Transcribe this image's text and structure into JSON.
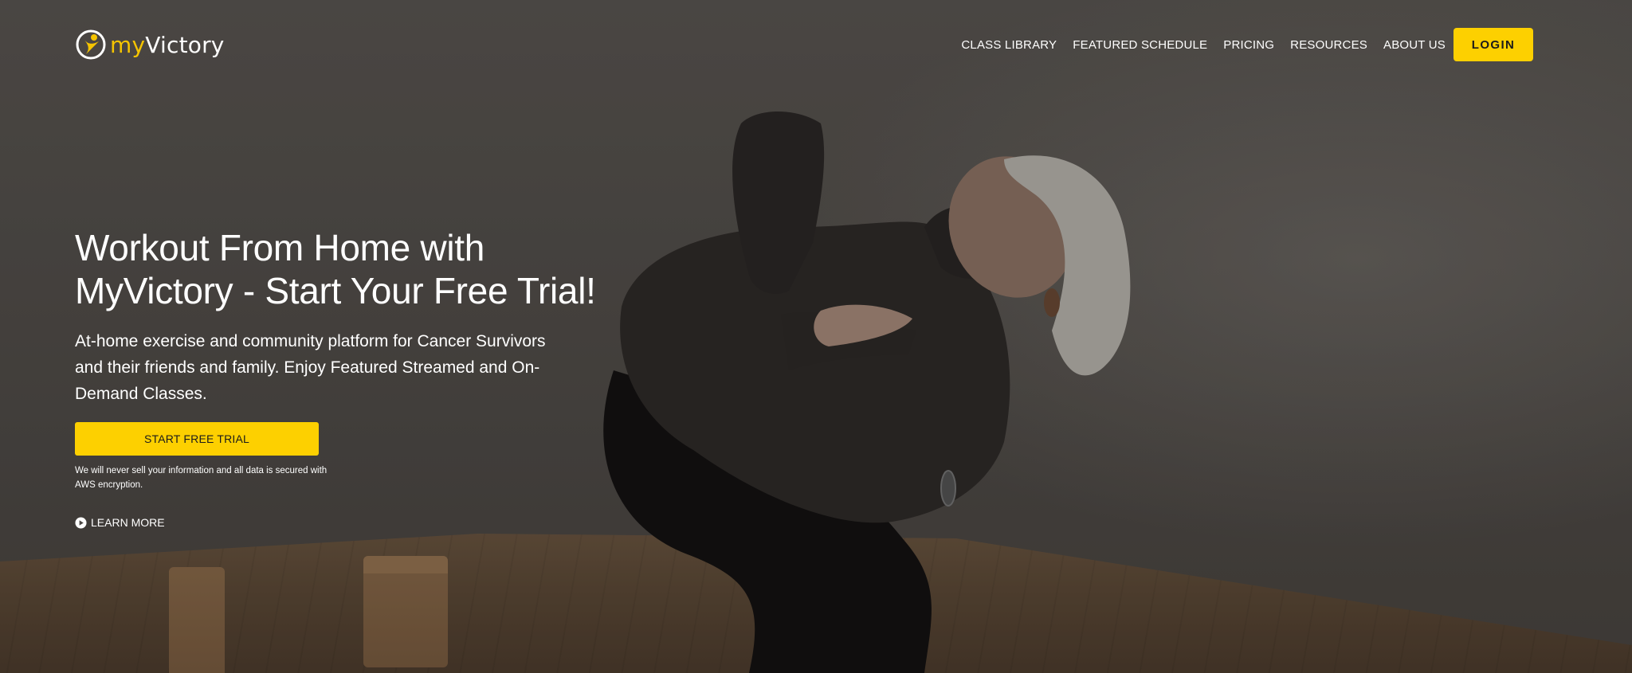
{
  "brand": {
    "logo_prefix": "my",
    "logo_suffix": "Victory",
    "accent_color": "#fdd000",
    "logo_icon": "person-circle-icon"
  },
  "nav": {
    "items": [
      {
        "label": "CLASS LIBRARY"
      },
      {
        "label": "FEATURED SCHEDULE"
      },
      {
        "label": "PRICING"
      },
      {
        "label": "RESOURCES"
      },
      {
        "label": "ABOUT US"
      }
    ],
    "login_label": "LOGIN"
  },
  "hero": {
    "headline_line1": "Workout From Home with",
    "headline_line2": "MyVictory - Start Your Free Trial!",
    "subtext": "At-home exercise and community platform for Cancer Survivors and their friends and family. Enjoy Featured Streamed and On-Demand Classes.",
    "cta_label": "START FREE TRIAL",
    "disclaimer": "We will never sell your information and all data is secured with AWS encryption.",
    "learn_more_label": "LEARN MORE",
    "learn_more_icon": "play-circle-icon"
  }
}
